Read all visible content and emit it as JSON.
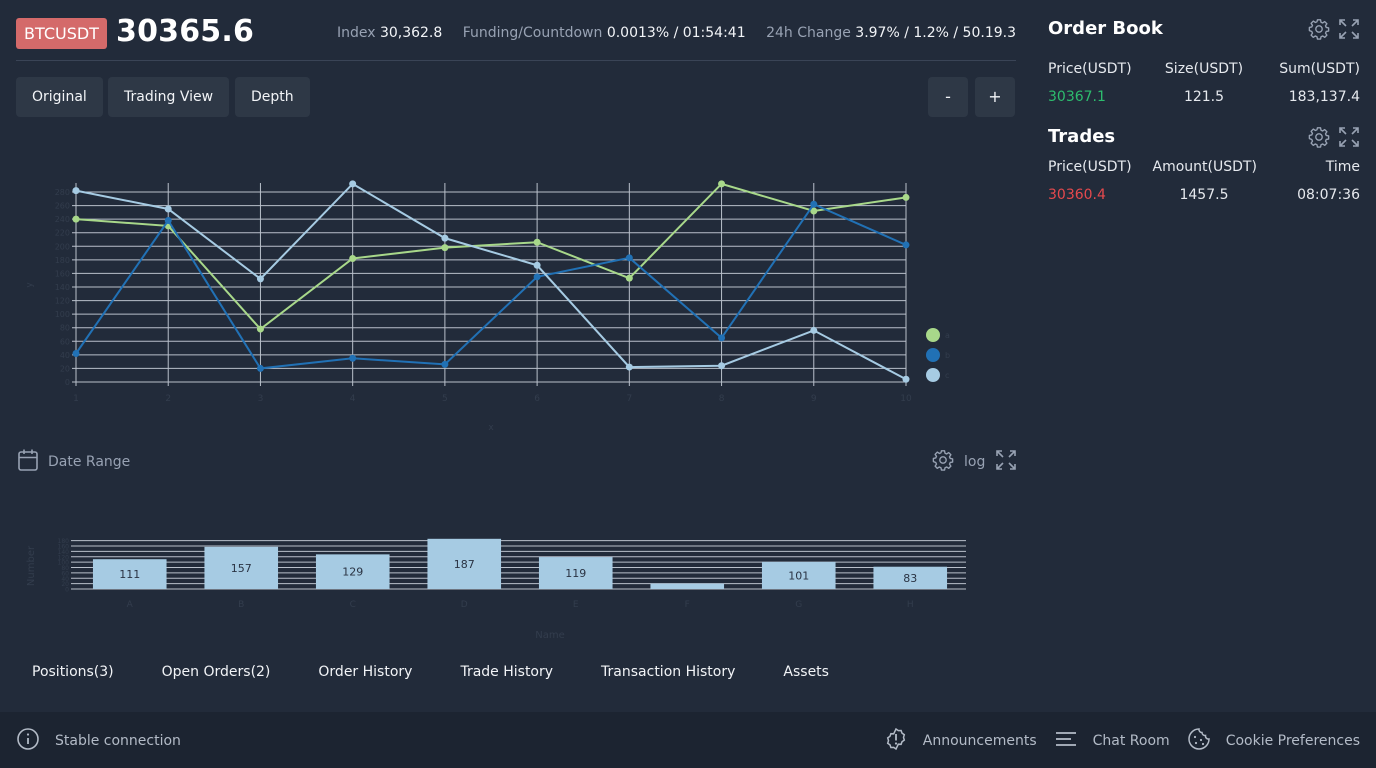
{
  "ticker": {
    "symbol": "BTCUSDT",
    "last_price": "30365.6",
    "index_label": "Index",
    "index_value": "30,362.8",
    "funding_label": "Funding/Countdown",
    "funding_value": "0.0013% / 01:54:41",
    "change_label": "24h Change",
    "change_value": "3.97% / 1.2% / 50.19.3"
  },
  "view_buttons": [
    "Original",
    "Trading View",
    "Depth"
  ],
  "zoom": {
    "minus": "-",
    "plus": "+"
  },
  "date_range_label": "Date Range",
  "log_label": "log",
  "colors": {
    "accent_sell": "#e5494d",
    "accent_buy": "#2dbd6e",
    "badge": "#d46a6a",
    "series_a": "#a8d88a",
    "series_b": "#2171b5",
    "series_c": "#a6cbe3"
  },
  "chart_data": [
    {
      "type": "line",
      "x": [
        1,
        2,
        3,
        4,
        5,
        6,
        7,
        8,
        9,
        10
      ],
      "series": [
        {
          "values": [
            240,
            230,
            78,
            182,
            198,
            206,
            153,
            292,
            252,
            272
          ]
        },
        {
          "values": [
            42,
            238,
            20,
            35,
            26,
            155,
            183,
            65,
            262,
            202
          ]
        },
        {
          "values": [
            282,
            255,
            152,
            292,
            212,
            172,
            22,
            24,
            76,
            4
          ]
        }
      ],
      "xlabel": "x",
      "ylabel": "y",
      "ylim": [
        0,
        280
      ],
      "yticks": [
        0,
        20,
        40,
        60,
        80,
        100,
        120,
        140,
        160,
        180,
        200,
        220,
        240,
        260,
        280
      ],
      "legend": [
        "a",
        "b",
        "c"
      ],
      "legend_position": "right",
      "grid": true
    },
    {
      "type": "bar",
      "categories": [
        "A",
        "B",
        "C",
        "D",
        "E",
        "F",
        "G",
        "H"
      ],
      "values": [
        111,
        157,
        129,
        187,
        119,
        20,
        101,
        83
      ],
      "data_labels": [
        "111",
        "157",
        "129",
        "187",
        "119",
        "",
        "101",
        "83"
      ],
      "xlabel": "Name",
      "ylabel": "Number",
      "ylim": [
        0,
        190
      ],
      "yticks": [
        0,
        20,
        40,
        60,
        80,
        100,
        120,
        140,
        160,
        180
      ],
      "grid": true
    }
  ],
  "tabs": [
    "Positions(3)",
    "Open Orders(2)",
    "Order History",
    "Trade History",
    "Transaction History",
    "Assets"
  ],
  "footer": {
    "status": "Stable connection",
    "announcements": "Announcements",
    "chat_room": "Chat Room",
    "cookie_preferences": "Cookie Preferences"
  },
  "order_book": {
    "title": "Order Book",
    "headers": [
      "Price(USDT)",
      "Size(USDT)",
      "Sum(USDT)"
    ],
    "rows": [
      [
        "30367.1",
        "121.5",
        "183,137.4"
      ]
    ]
  },
  "trades": {
    "title": "Trades",
    "headers": [
      "Price(USDT)",
      "Amount(USDT)",
      "Time"
    ],
    "rows": [
      [
        "30360.4",
        "1457.5",
        "08:07:36"
      ]
    ]
  }
}
